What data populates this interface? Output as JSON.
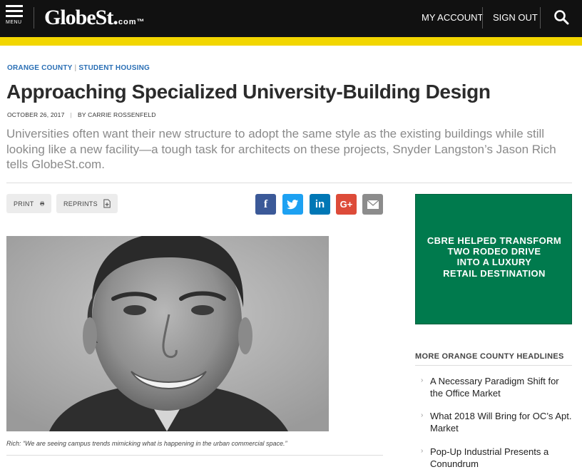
{
  "header": {
    "menu_label": "MENU",
    "logo_text": "GlobeSt.",
    "logo_suffix": "com™",
    "my_account": "MY ACCOUNT",
    "sign_out": "SIGN OUT",
    "search_icon": "search-icon",
    "accent_color": "#f2d600"
  },
  "article": {
    "category_1": "ORANGE COUNTY",
    "category_2": "STUDENT HOUSING",
    "title": "Approaching Specialized University-Building Design",
    "date": "OCTOBER 26, 2017",
    "byline": "BY CARRIE ROSSENFELD",
    "dek": "Universities often want their new structure to adopt the same style as the existing buildings while still looking like a new facility—a tough task for architects on these projects, Snyder Langston’s Jason Rich tells GlobeSt.com.",
    "print_label": "PRINT",
    "reprints_label": "REPRINTS",
    "share": [
      {
        "name": "facebook",
        "glyph": "f",
        "color": "#3b5998"
      },
      {
        "name": "twitter",
        "glyph": "t",
        "color": "#1da1f2"
      },
      {
        "name": "linkedin",
        "glyph": "in",
        "color": "#0077b5"
      },
      {
        "name": "google-plus",
        "glyph": "G+",
        "color": "#dd4b39"
      },
      {
        "name": "email",
        "glyph": "✉",
        "color": "#8c8c8c"
      }
    ],
    "caption": "Rich: “We are seeing campus trends mimicking what is happening in the urban commercial space.”"
  },
  "sidebar": {
    "ad_lines": [
      "CBRE HELPED TRANSFORM",
      "TWO RODEO DRIVE",
      "INTO A LUXURY",
      "RETAIL DESTINATION"
    ],
    "ad_color": "#007a4d",
    "headlines_title": "MORE ORANGE COUNTY HEADLINES",
    "headlines": [
      "A Necessary Paradigm Shift for the Office Market",
      "What 2018 Will Bring for OC’s Apt. Market",
      "Pop-Up Industrial Presents a Conundrum"
    ]
  }
}
